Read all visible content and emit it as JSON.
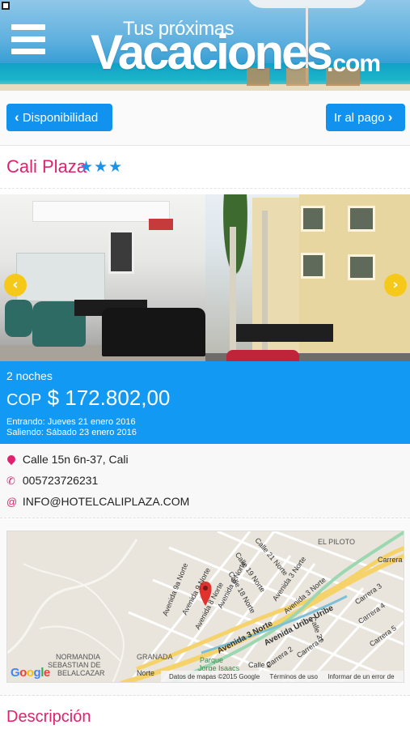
{
  "header": {
    "logo_top": "Tus próximas",
    "logo_main": "Vacaciones",
    "logo_suffix": ".com"
  },
  "nav": {
    "back_label": "Disponibilidad",
    "next_label": "Ir al pago"
  },
  "hotel": {
    "name": "Cali Plaza",
    "stars": "★★★",
    "star_count": 3
  },
  "gallery": {
    "prev_icon": "chevron-left-icon",
    "next_icon": "chevron-right-icon"
  },
  "booking": {
    "nights": "2 noches",
    "currency": "COP",
    "price": "$ 172.802,00",
    "check_in": "Entrando: Jueves 21 enero 2016",
    "check_out": "Saliendo: Sábado 23 enero 2016"
  },
  "contact": {
    "address": "Calle 15n 6n-37, Cali",
    "phone": "005723726231",
    "email": "INFO@HOTELCALIPLAZA.COM"
  },
  "map": {
    "labels": {
      "el_piloto": "EL PILOTO",
      "carrera": "Carrera",
      "calle21n": "Calle 21 Norte",
      "calle19n": "Calle 19 Norte",
      "calle18n": "Calle 18 Norte",
      "av3n_a": "Avenida 3 Norte",
      "av3n_b": "Avenida 3 Norte",
      "av9an": "Avenida 9a Norte",
      "av9n": "Avenida 9 Norte",
      "av8n": "Avenida 8 Norte",
      "av6n": "Avenida 6 Norte",
      "av3norte_big": "Avenida 3 Norte",
      "uribe": "Avenida Uribe Uribe",
      "carrera3": "Carrera 3",
      "carrera4": "Carrera 4",
      "carrera5": "Carrera 5",
      "carrera2": "Carrera 2",
      "carrera3b": "Carrera 3",
      "calle21": "Calle 21",
      "normandia": "NORMANDIA",
      "sebastian": "SEBASTIAN DE",
      "belalcazar": "BELALCAZAR",
      "granada": "GRANADA",
      "parque": "Parque",
      "jorge": "Jorge Isaacs",
      "norte": "Norte",
      "calle2": "Calle 2"
    },
    "google": "Google",
    "footer_data": "Datos de mapas ©2015 Google",
    "footer_terms": "Términos de uso",
    "footer_report": "Informar de un error de Maps"
  },
  "description": {
    "heading": "Descripción"
  },
  "colors": {
    "accent_blue": "#1192ee",
    "brand_pink": "#e0226e",
    "price_bg": "#1199f3",
    "arrow_yellow": "#f6c81a"
  }
}
